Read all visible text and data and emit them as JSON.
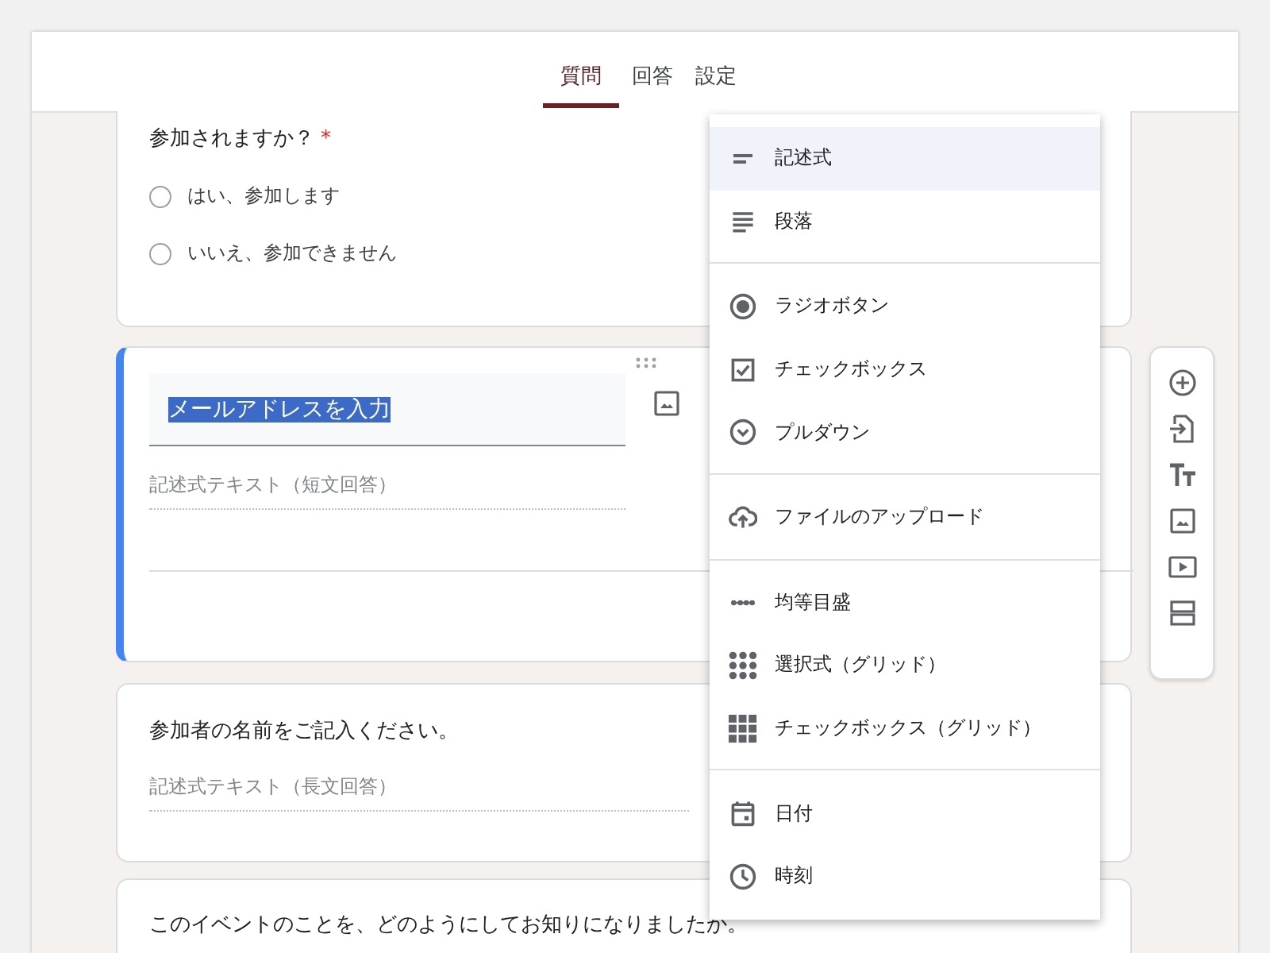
{
  "tabs": [
    {
      "label": "質問",
      "selected": true
    },
    {
      "label": "回答",
      "selected": false
    },
    {
      "label": "設定",
      "selected": false
    }
  ],
  "questions": [
    {
      "kind": "choice",
      "title": "参加されますか？",
      "required_mark": "*",
      "options": [
        {
          "label": "はい、参加します",
          "selected": false
        },
        {
          "label": "いいえ、参加できません",
          "selected": false
        }
      ]
    },
    {
      "kind": "editing",
      "title": "メールアドレスを入力",
      "title_selected": true,
      "answer_placeholder": "記述式テキスト（短文回答）"
    },
    {
      "kind": "text",
      "title": "参加者の名前をご記入ください。",
      "answer_placeholder": "記述式テキスト（長文回答）"
    },
    {
      "kind": "header",
      "title": "このイベントのことを、どのようにしてお知りになりましたか。"
    }
  ],
  "type_menu": [
    {
      "kind": "short",
      "label": "記述式",
      "selected": true
    },
    {
      "kind": "paragraph",
      "label": "段落",
      "selected": false
    },
    {
      "kind": "divider"
    },
    {
      "kind": "radio",
      "label": "ラジオボタン",
      "selected": false
    },
    {
      "kind": "checkbox",
      "label": "チェックボックス",
      "selected": false
    },
    {
      "kind": "dropdown",
      "label": "プルダウン",
      "selected": false
    },
    {
      "kind": "divider"
    },
    {
      "kind": "upload",
      "label": "ファイルのアップロード",
      "selected": false
    },
    {
      "kind": "divider"
    },
    {
      "kind": "scale",
      "label": "均等目盛",
      "selected": false
    },
    {
      "kind": "grid-radio",
      "label": "選択式（グリッド）",
      "selected": false
    },
    {
      "kind": "grid-check",
      "label": "チェックボックス（グリッド）",
      "selected": false
    },
    {
      "kind": "divider"
    },
    {
      "kind": "date",
      "label": "日付",
      "selected": false
    },
    {
      "kind": "time",
      "label": "時刻",
      "selected": false
    }
  ]
}
